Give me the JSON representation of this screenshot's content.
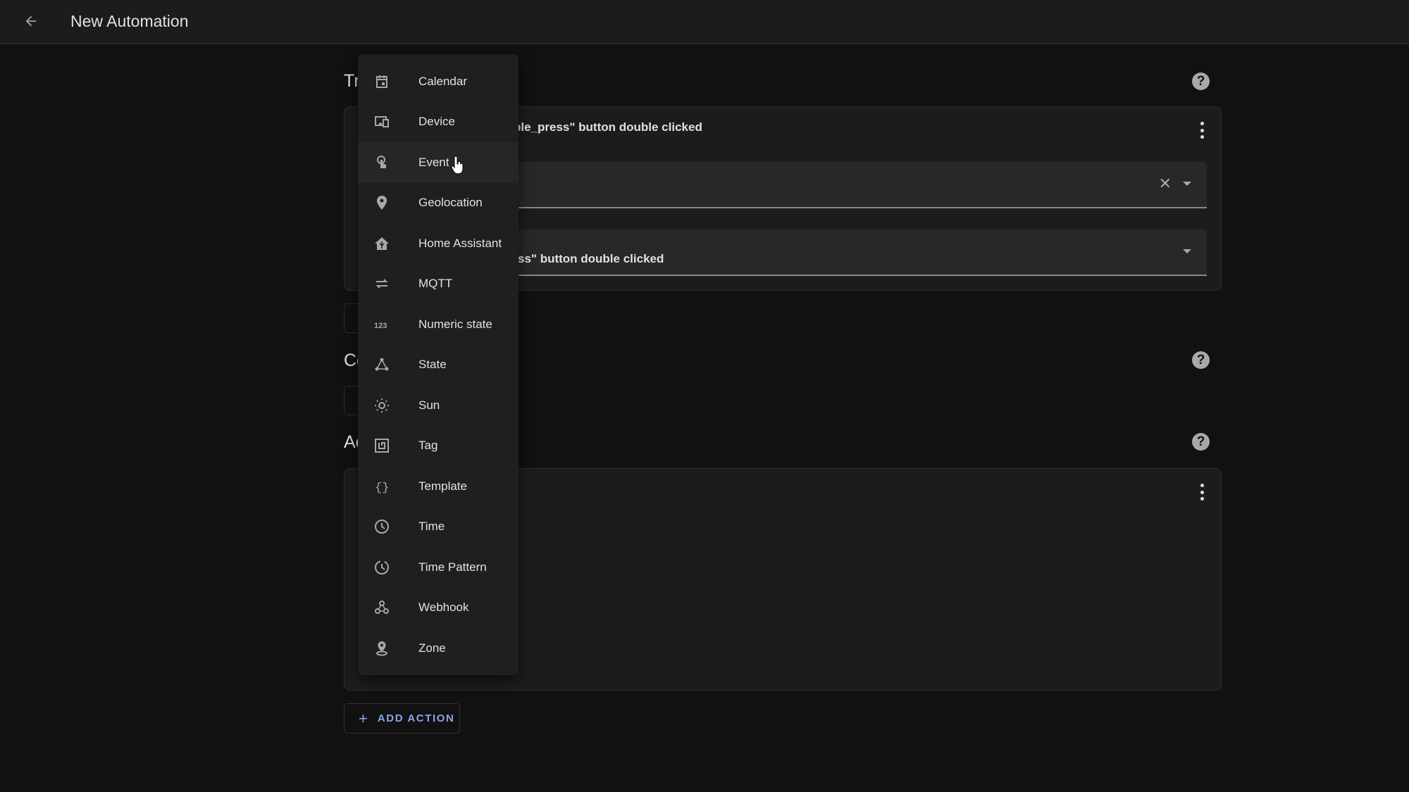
{
  "header": {
    "title": "New Automation",
    "back_icon": "arrow-left-icon"
  },
  "sections": {
    "triggers": {
      "title": "Triggers",
      "visible_title": "Tr"
    },
    "conditions": {
      "title": "Conditions",
      "visible_title": "Co"
    },
    "actions": {
      "title": "Actions",
      "visible_title": "Ac"
    }
  },
  "trigger_card": {
    "heading_visible": "ble_press\" button double clicked",
    "field1_value": "",
    "field2_value_visible": "ss\" button double clicked"
  },
  "add_action": {
    "label": "ADD ACTION"
  },
  "menu": {
    "hovered_index": 2,
    "items": [
      {
        "label": "Calendar",
        "icon": "calendar-icon"
      },
      {
        "label": "Device",
        "icon": "devices-icon"
      },
      {
        "label": "Event",
        "icon": "gesture-tap-icon"
      },
      {
        "label": "Geolocation",
        "icon": "map-marker-icon"
      },
      {
        "label": "Home Assistant",
        "icon": "home-assistant-icon"
      },
      {
        "label": "MQTT",
        "icon": "swap-horizontal-icon"
      },
      {
        "label": "Numeric state",
        "icon": "numeric-icon"
      },
      {
        "label": "State",
        "icon": "state-graph-icon"
      },
      {
        "label": "Sun",
        "icon": "sun-icon"
      },
      {
        "label": "Tag",
        "icon": "nfc-tag-icon"
      },
      {
        "label": "Template",
        "icon": "code-braces-icon"
      },
      {
        "label": "Time",
        "icon": "clock-icon"
      },
      {
        "label": "Time Pattern",
        "icon": "clock-pattern-icon"
      },
      {
        "label": "Webhook",
        "icon": "webhook-icon"
      },
      {
        "label": "Zone",
        "icon": "map-marker-radius-icon"
      }
    ]
  }
}
